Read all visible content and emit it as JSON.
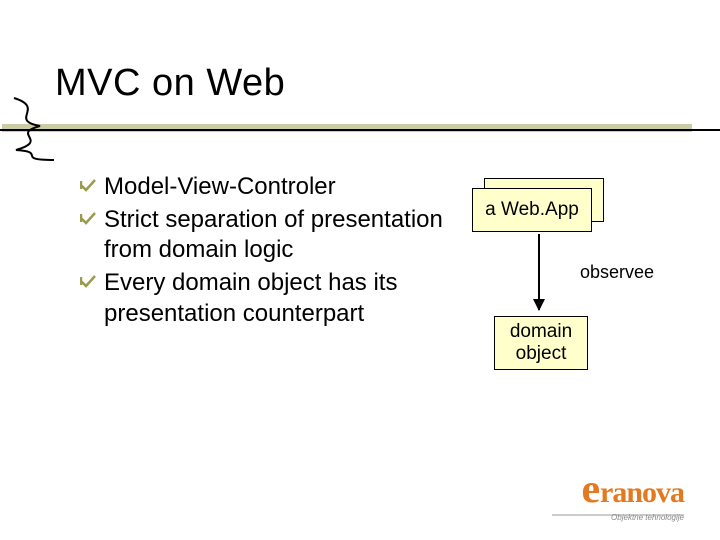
{
  "title": "MVC on Web",
  "bullets": [
    {
      "text": "Model-View-Controler"
    },
    {
      "text": "Strict separation of presentation from domain logic"
    },
    {
      "text": "Every domain object  has its presentation counterpart"
    }
  ],
  "diagram": {
    "box_a": "a Web.App",
    "box_b": "domain object",
    "edge_label": "observee"
  },
  "logo": {
    "e": "e",
    "rest": "ranova",
    "sub": "Objektne tehnologije"
  }
}
